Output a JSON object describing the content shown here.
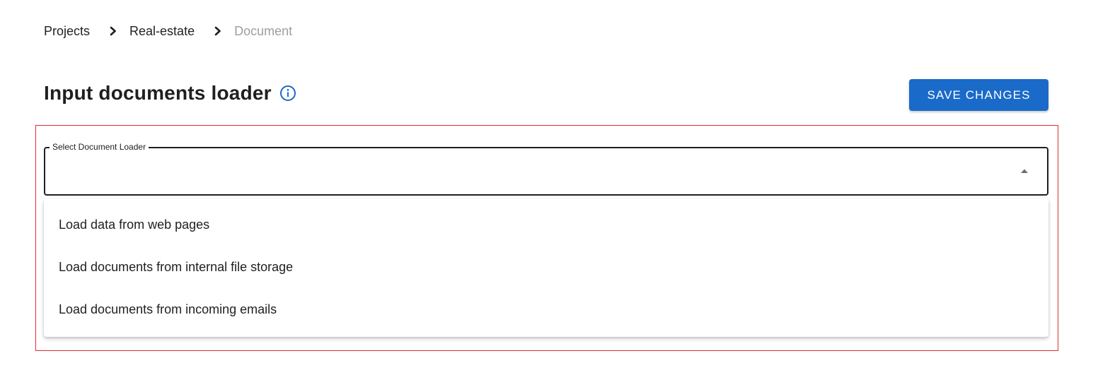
{
  "breadcrumb": {
    "items": [
      {
        "label": "Projects"
      },
      {
        "label": "Real-estate"
      },
      {
        "label": "Document"
      }
    ]
  },
  "header": {
    "title": "Input documents loader",
    "info_icon": "info-circle-icon"
  },
  "toolbar": {
    "save_label": "SAVE CHANGES"
  },
  "select": {
    "label": "Select Document Loader",
    "value": "",
    "expanded": true,
    "arrow_icon": "caret-up-icon"
  },
  "dropdown": {
    "options": [
      {
        "label": "Load data from web pages"
      },
      {
        "label": "Load documents from internal file storage"
      },
      {
        "label": "Load documents from incoming emails"
      }
    ]
  },
  "colors": {
    "primary": "#1a6ac9",
    "highlight_border": "#d93030",
    "muted_text": "#9e9e9e"
  }
}
